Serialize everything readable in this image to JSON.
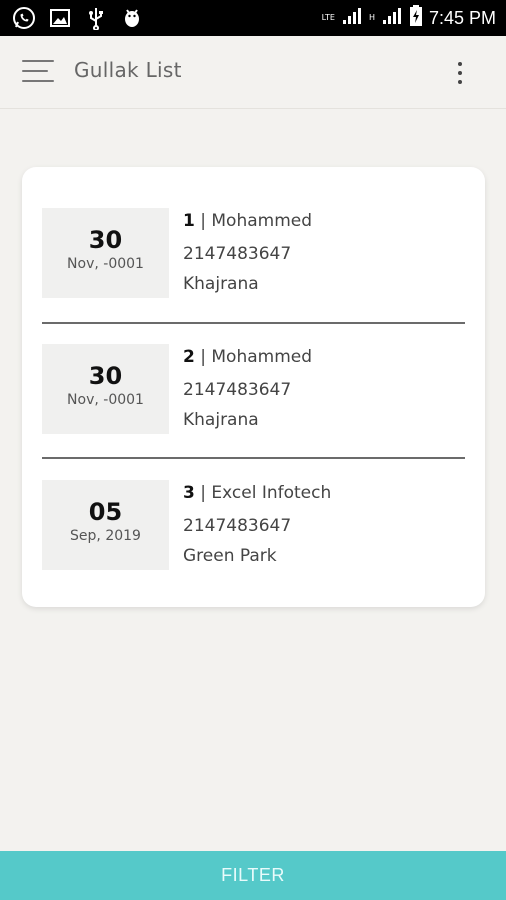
{
  "status_bar": {
    "time": "7:45 PM",
    "network_label_1": "LTE",
    "network_label_2": "H",
    "icons": [
      "whatsapp-icon",
      "gallery-icon",
      "usb-icon",
      "android-debug-icon",
      "signal-icon",
      "signal-icon",
      "battery-charging-icon"
    ]
  },
  "app_bar": {
    "title": "Gullak List",
    "menu_icon": "hamburger-menu-icon",
    "more_icon": "more-vertical-icon"
  },
  "items": [
    {
      "day": "30",
      "month_year": "Nov, -0001",
      "number": "1",
      "separator": " | ",
      "name": "Mohammed",
      "phone": "2147483647",
      "location": "Khajrana"
    },
    {
      "day": "30",
      "month_year": "Nov, -0001",
      "number": "2",
      "separator": " | ",
      "name": "Mohammed",
      "phone": "2147483647",
      "location": "Khajrana"
    },
    {
      "day": "05",
      "month_year": "Sep, 2019",
      "number": "3",
      "separator": " | ",
      "name": "Excel Infotech",
      "phone": "2147483647",
      "location": "Green Park"
    }
  ],
  "filter_button": {
    "label": "FILTER",
    "color": "#55c9c9"
  }
}
